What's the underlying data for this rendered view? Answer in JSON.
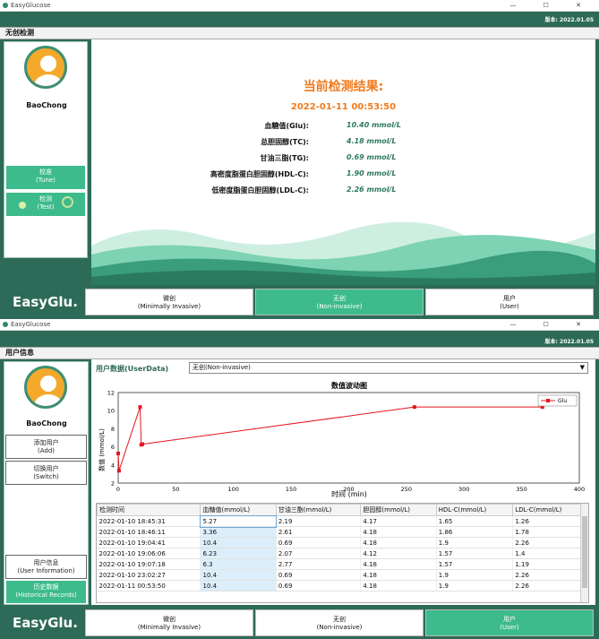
{
  "window1": {
    "title": "EasyGlucose",
    "controls": "— ☐ ✕",
    "version": "版本: 2022.01.05",
    "section": "无创检测",
    "user_name": "BaoChong",
    "buttons": {
      "tune": {
        "cn": "校准",
        "en": "(Tune)"
      },
      "test": {
        "cn": "检测",
        "en": "(Test)"
      }
    },
    "result": {
      "title": "当前检测结果:",
      "time": "2022-01-11 00:53:50",
      "rows": [
        {
          "label": "血糖值(Glu):",
          "value": "10.40 mmol/L"
        },
        {
          "label": "总胆固醇(TC):",
          "value": "4.18 mmol/L"
        },
        {
          "label": "甘油三脂(TG):",
          "value": "0.69 mmol/L"
        },
        {
          "label": "高密度脂蛋白胆固醇(HDL-C):",
          "value": "1.90 mmol/L"
        },
        {
          "label": "低密度脂蛋白胆固醇(LDL-C):",
          "value": "2.26 mmol/L"
        }
      ]
    },
    "logo": "EasyGlu.",
    "nav": [
      {
        "cn": "微创",
        "en": "(Minimally Invasive)"
      },
      {
        "cn": "无创",
        "en": "(Non-invasive)"
      },
      {
        "cn": "用户",
        "en": "(User)"
      }
    ],
    "nav_active": 1
  },
  "window2": {
    "title": "EasyGlucose",
    "controls": "— ☐ ✕",
    "version": "版本: 2022.01.05",
    "section": "用户信息",
    "user_name": "BaoChong",
    "buttons": {
      "add": {
        "cn": "添加用户",
        "en": "(Add)"
      },
      "switch": {
        "cn": "切换用户",
        "en": "(Switch)"
      },
      "info": {
        "cn": "用户信息",
        "en": "(User Information)"
      },
      "history": {
        "cn": "历史数据",
        "en": "(Historical Records)"
      }
    },
    "userdata_label": "用户数据(UserData)",
    "dropdown_value": "无创(Non-invasive)",
    "logo": "EasyGlu.",
    "nav": [
      {
        "cn": "微创",
        "en": "(Minimally Invasive)"
      },
      {
        "cn": "无创",
        "en": "(Non-invasive)"
      },
      {
        "cn": "用户",
        "en": "(User)"
      }
    ],
    "nav_active": 2,
    "table": {
      "headers": [
        "检测时间",
        "血糖值(mmol/L)",
        "甘油三酯(mmol/L)",
        "胆固醇(mmol/L)",
        "HDL-C(mmol/L)",
        "LDL-C(mmol/L)"
      ],
      "rows": [
        [
          "2022-01-10 18:45:31",
          "5.27",
          "2.19",
          "4.17",
          "1.65",
          "1.26"
        ],
        [
          "2022-01-10 18:46:11",
          "3.36",
          "2.61",
          "4.18",
          "1.86",
          "1.78"
        ],
        [
          "2022-01-10 19:04:41",
          "10.4",
          "0.69",
          "4.18",
          "1.9",
          "2.26"
        ],
        [
          "2022-01-10 19:06:06",
          "6.23",
          "2.07",
          "4.12",
          "1.57",
          "1.4"
        ],
        [
          "2022-01-10 19:07:18",
          "6.3",
          "2.77",
          "4.18",
          "1.57",
          "1.19"
        ],
        [
          "2022-01-10 23:02:27",
          "10.4",
          "0.69",
          "4.18",
          "1.9",
          "2.26"
        ],
        [
          "2022-01-11 00:53:50",
          "10.4",
          "0.69",
          "4.18",
          "1.9",
          "2.26"
        ]
      ]
    }
  },
  "chart_data": {
    "type": "line",
    "title": "数值波动图",
    "xlabel": "时间 (min)",
    "ylabel": "数值 (mmol/L)",
    "xlim": [
      0,
      400
    ],
    "ylim": [
      2,
      12
    ],
    "xticks": [
      0,
      50,
      100,
      150,
      200,
      250,
      300,
      350,
      400
    ],
    "yticks": [
      2,
      4,
      6,
      8,
      10,
      12
    ],
    "grid": true,
    "legend": "top-right",
    "series": [
      {
        "name": "Glu",
        "color": "#e8141c",
        "x": [
          0,
          0.7,
          19,
          20,
          21,
          257,
          368
        ],
        "y": [
          5.27,
          3.36,
          10.4,
          6.23,
          6.3,
          10.4,
          10.4
        ]
      }
    ]
  },
  "colors": {
    "accent": "#3dbb8c",
    "dark": "#2e6a58",
    "result": "#f07a1e",
    "value": "#2e7a5e",
    "line": "#e8141c"
  }
}
